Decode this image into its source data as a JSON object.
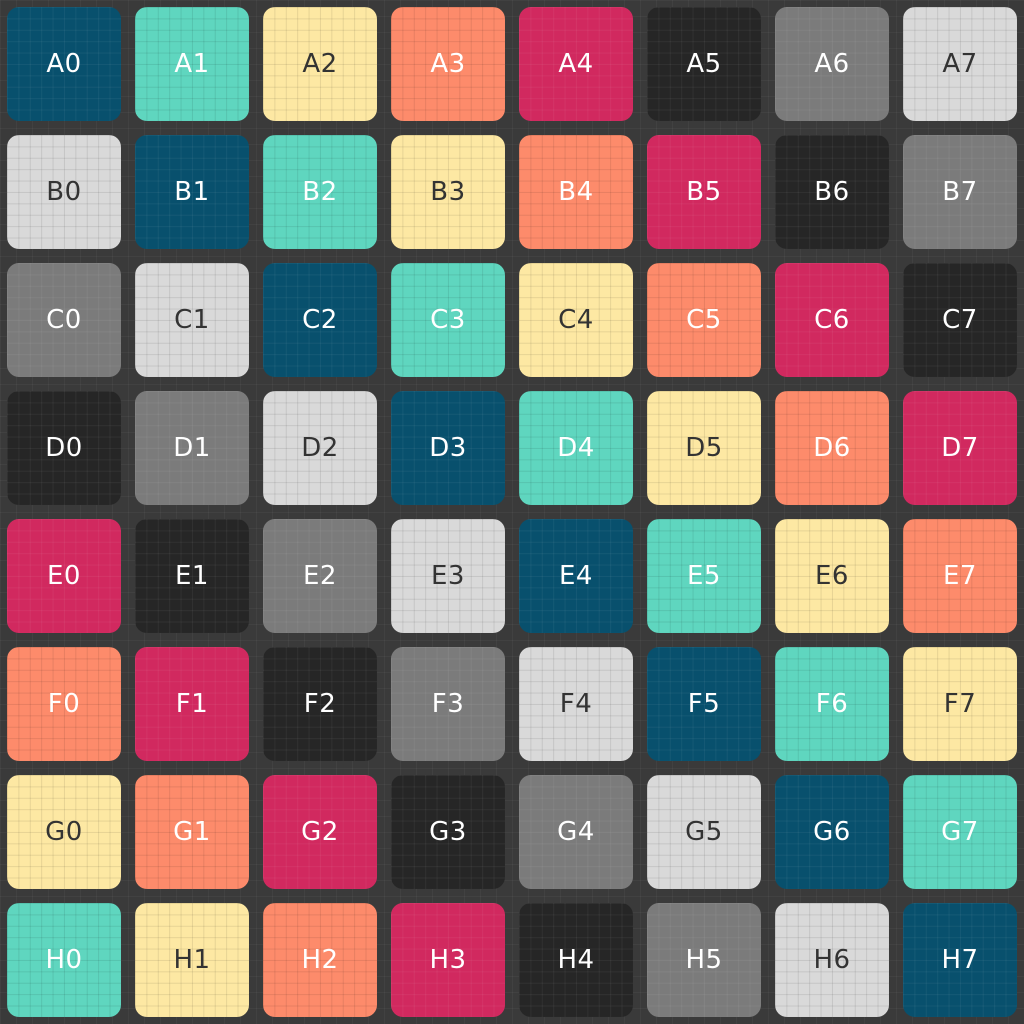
{
  "palette": {
    "navy": "#08506d",
    "teal": "#5fd6bf",
    "cream": "#fde8a3",
    "salmon": "#fd8b6b",
    "crimson": "#d1295f",
    "black": "#262626",
    "gray": "#7b7b7b",
    "light": "#d9d9d9"
  },
  "text_colors": {
    "navy": "#ffffff",
    "teal": "#ffffff",
    "cream": "#333333",
    "salmon": "#ffffff",
    "crimson": "#ffffff",
    "black": "#ffffff",
    "gray": "#ffffff",
    "light": "#333333"
  },
  "rows": [
    {
      "id": "A",
      "tiles": [
        {
          "label": "A0",
          "color": "navy"
        },
        {
          "label": "A1",
          "color": "teal"
        },
        {
          "label": "A2",
          "color": "cream"
        },
        {
          "label": "A3",
          "color": "salmon"
        },
        {
          "label": "A4",
          "color": "crimson"
        },
        {
          "label": "A5",
          "color": "black"
        },
        {
          "label": "A6",
          "color": "gray"
        },
        {
          "label": "A7",
          "color": "light"
        }
      ]
    },
    {
      "id": "B",
      "tiles": [
        {
          "label": "B0",
          "color": "light"
        },
        {
          "label": "B1",
          "color": "navy"
        },
        {
          "label": "B2",
          "color": "teal"
        },
        {
          "label": "B3",
          "color": "cream"
        },
        {
          "label": "B4",
          "color": "salmon"
        },
        {
          "label": "B5",
          "color": "crimson"
        },
        {
          "label": "B6",
          "color": "black"
        },
        {
          "label": "B7",
          "color": "gray"
        }
      ]
    },
    {
      "id": "C",
      "tiles": [
        {
          "label": "C0",
          "color": "gray"
        },
        {
          "label": "C1",
          "color": "light"
        },
        {
          "label": "C2",
          "color": "navy"
        },
        {
          "label": "C3",
          "color": "teal"
        },
        {
          "label": "C4",
          "color": "cream"
        },
        {
          "label": "C5",
          "color": "salmon"
        },
        {
          "label": "C6",
          "color": "crimson"
        },
        {
          "label": "C7",
          "color": "black"
        }
      ]
    },
    {
      "id": "D",
      "tiles": [
        {
          "label": "D0",
          "color": "black"
        },
        {
          "label": "D1",
          "color": "gray"
        },
        {
          "label": "D2",
          "color": "light"
        },
        {
          "label": "D3",
          "color": "navy"
        },
        {
          "label": "D4",
          "color": "teal"
        },
        {
          "label": "D5",
          "color": "cream"
        },
        {
          "label": "D6",
          "color": "salmon"
        },
        {
          "label": "D7",
          "color": "crimson"
        }
      ]
    },
    {
      "id": "E",
      "tiles": [
        {
          "label": "E0",
          "color": "crimson"
        },
        {
          "label": "E1",
          "color": "black"
        },
        {
          "label": "E2",
          "color": "gray"
        },
        {
          "label": "E3",
          "color": "light"
        },
        {
          "label": "E4",
          "color": "navy"
        },
        {
          "label": "E5",
          "color": "teal"
        },
        {
          "label": "E6",
          "color": "cream"
        },
        {
          "label": "E7",
          "color": "salmon"
        }
      ]
    },
    {
      "id": "F",
      "tiles": [
        {
          "label": "F0",
          "color": "salmon"
        },
        {
          "label": "F1",
          "color": "crimson"
        },
        {
          "label": "F2",
          "color": "black"
        },
        {
          "label": "F3",
          "color": "gray"
        },
        {
          "label": "F4",
          "color": "light"
        },
        {
          "label": "F5",
          "color": "navy"
        },
        {
          "label": "F6",
          "color": "teal"
        },
        {
          "label": "F7",
          "color": "cream"
        }
      ]
    },
    {
      "id": "G",
      "tiles": [
        {
          "label": "G0",
          "color": "cream"
        },
        {
          "label": "G1",
          "color": "salmon"
        },
        {
          "label": "G2",
          "color": "crimson"
        },
        {
          "label": "G3",
          "color": "black"
        },
        {
          "label": "G4",
          "color": "gray"
        },
        {
          "label": "G5",
          "color": "light"
        },
        {
          "label": "G6",
          "color": "navy"
        },
        {
          "label": "G7",
          "color": "teal"
        }
      ]
    },
    {
      "id": "H",
      "tiles": [
        {
          "label": "H0",
          "color": "teal"
        },
        {
          "label": "H1",
          "color": "cream"
        },
        {
          "label": "H2",
          "color": "salmon"
        },
        {
          "label": "H3",
          "color": "crimson"
        },
        {
          "label": "H4",
          "color": "black"
        },
        {
          "label": "H5",
          "color": "gray"
        },
        {
          "label": "H6",
          "color": "light"
        },
        {
          "label": "H7",
          "color": "navy"
        }
      ]
    }
  ]
}
